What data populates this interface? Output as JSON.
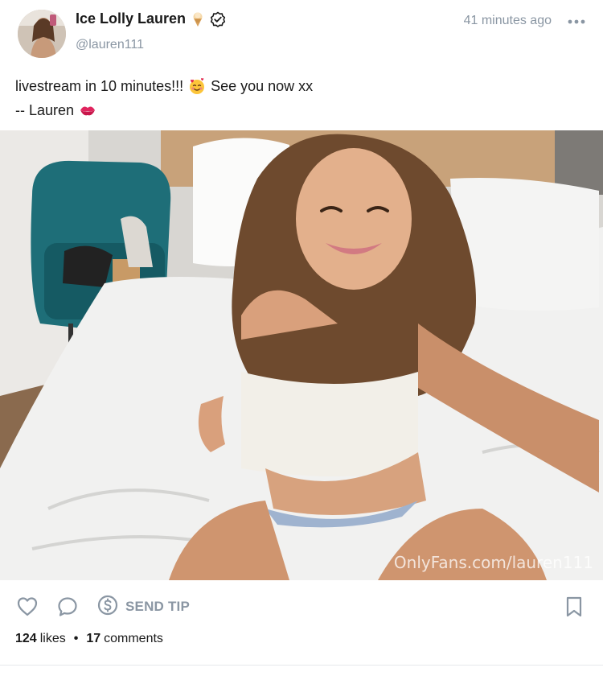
{
  "post": {
    "author_name": "Ice Lolly Lauren",
    "author_handle": "@lauren111",
    "timestamp": "41 minutes ago",
    "caption_line1": "livestream in 10 minutes!!!",
    "caption_line1_suffix": "See you now xx",
    "caption_line2": "-- Lauren",
    "watermark": "OnlyFans.com/lauren111",
    "icons": {
      "name_badge_1": "ice-cream-icon",
      "name_badge_2": "verified-icon",
      "menu": "more-horizontal-icon",
      "emoji_1": "smiling-face-with-hearts-icon",
      "emoji_2": "kiss-mark-icon"
    }
  },
  "actions": {
    "send_tip_label": "SEND TIP",
    "icons": [
      "heart-icon",
      "comment-icon",
      "dollar-icon",
      "bookmark-icon"
    ]
  },
  "stats": {
    "likes_count": "124",
    "likes_label": "likes",
    "comments_count": "17",
    "comments_label": "comments"
  },
  "colors": {
    "muted_text": "#8a96a3",
    "primary_text": "#1a1a1a",
    "divider": "#e5e8eb"
  }
}
